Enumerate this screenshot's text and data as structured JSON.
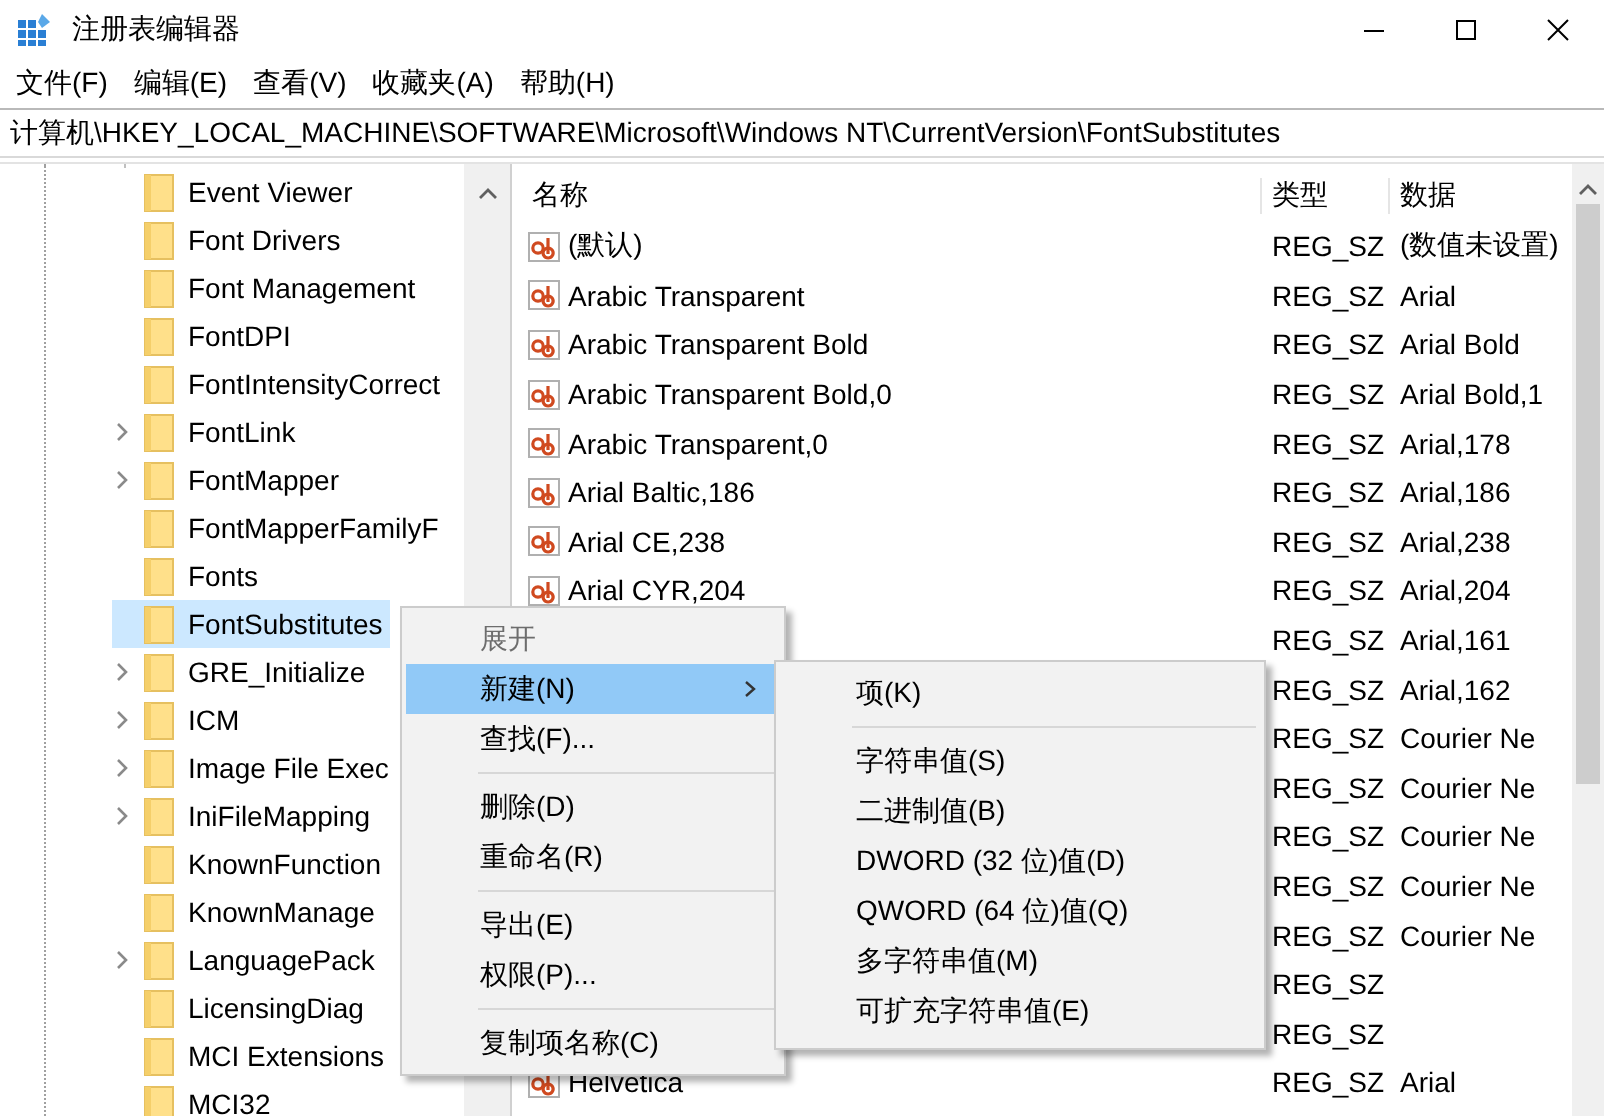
{
  "window": {
    "title": "注册表编辑器"
  },
  "menu_bar": [
    "文件(F)",
    "编辑(E)",
    "查看(V)",
    "收藏夹(A)",
    "帮助(H)"
  ],
  "address": "计算机\\HKEY_LOCAL_MACHINE\\SOFTWARE\\Microsoft\\Windows NT\\CurrentVersion\\FontSubstitutes",
  "tree": {
    "items": [
      {
        "label": "Event Viewer",
        "expandable": false,
        "selected": false
      },
      {
        "label": "Font Drivers",
        "expandable": false,
        "selected": false
      },
      {
        "label": "Font Management",
        "expandable": false,
        "selected": false
      },
      {
        "label": "FontDPI",
        "expandable": false,
        "selected": false
      },
      {
        "label": "FontIntensityCorrect",
        "expandable": false,
        "selected": false
      },
      {
        "label": "FontLink",
        "expandable": true,
        "selected": false
      },
      {
        "label": "FontMapper",
        "expandable": true,
        "selected": false
      },
      {
        "label": "FontMapperFamilyF",
        "expandable": false,
        "selected": false
      },
      {
        "label": "Fonts",
        "expandable": false,
        "selected": false
      },
      {
        "label": "FontSubstitutes",
        "expandable": false,
        "selected": true
      },
      {
        "label": "GRE_Initialize",
        "expandable": true,
        "selected": false
      },
      {
        "label": "ICM",
        "expandable": true,
        "selected": false
      },
      {
        "label": "Image File Exec",
        "expandable": true,
        "selected": false
      },
      {
        "label": "IniFileMapping",
        "expandable": true,
        "selected": false
      },
      {
        "label": "KnownFunction",
        "expandable": false,
        "selected": false
      },
      {
        "label": "KnownManage",
        "expandable": false,
        "selected": false
      },
      {
        "label": "LanguagePack",
        "expandable": true,
        "selected": false
      },
      {
        "label": "LicensingDiag",
        "expandable": false,
        "selected": false
      },
      {
        "label": "MCI Extensions",
        "expandable": false,
        "selected": false
      },
      {
        "label": "MCI32",
        "expandable": false,
        "selected": false
      }
    ]
  },
  "list": {
    "columns": [
      "名称",
      "类型",
      "数据"
    ],
    "rows": [
      {
        "name": "(默认)",
        "type": "REG_SZ",
        "data": "(数值未设置)"
      },
      {
        "name": "Arabic Transparent",
        "type": "REG_SZ",
        "data": "Arial"
      },
      {
        "name": "Arabic Transparent Bold",
        "type": "REG_SZ",
        "data": "Arial Bold"
      },
      {
        "name": "Arabic Transparent Bold,0",
        "type": "REG_SZ",
        "data": "Arial Bold,1"
      },
      {
        "name": "Arabic Transparent,0",
        "type": "REG_SZ",
        "data": "Arial,178"
      },
      {
        "name": "Arial Baltic,186",
        "type": "REG_SZ",
        "data": "Arial,186"
      },
      {
        "name": "Arial CE,238",
        "type": "REG_SZ",
        "data": "Arial,238"
      },
      {
        "name": "Arial CYR,204",
        "type": "REG_SZ",
        "data": "Arial,204"
      },
      {
        "type": "REG_SZ",
        "data": "Arial,161"
      },
      {
        "type": "REG_SZ",
        "data": "Arial,162"
      },
      {
        "type": "REG_SZ",
        "data": "Courier Ne"
      },
      {
        "type": "REG_SZ",
        "data": "Courier Ne"
      },
      {
        "type": "REG_SZ",
        "data": "Courier Ne"
      },
      {
        "type": "REG_SZ",
        "data": "Courier Ne"
      },
      {
        "type": "REG_SZ",
        "data": "Courier Ne"
      },
      {
        "type": "REG_SZ"
      },
      {
        "type": "REG_SZ"
      },
      {
        "name": "Helvetica",
        "type": "REG_SZ",
        "data": "Arial"
      }
    ]
  },
  "context_menu": {
    "items": [
      {
        "kind": "item",
        "label": "展开",
        "disabled": true,
        "selected": false,
        "submenu": false
      },
      {
        "kind": "item",
        "label": "新建(N)",
        "disabled": false,
        "selected": true,
        "submenu": true
      },
      {
        "kind": "item",
        "label": "查找(F)...",
        "disabled": false,
        "selected": false,
        "submenu": false
      },
      {
        "kind": "separator"
      },
      {
        "kind": "item",
        "label": "删除(D)",
        "disabled": false,
        "selected": false,
        "submenu": false
      },
      {
        "kind": "item",
        "label": "重命名(R)",
        "disabled": false,
        "selected": false,
        "submenu": false
      },
      {
        "kind": "separator"
      },
      {
        "kind": "item",
        "label": "导出(E)",
        "disabled": false,
        "selected": false,
        "submenu": false
      },
      {
        "kind": "item",
        "label": "权限(P)...",
        "disabled": false,
        "selected": false,
        "submenu": false
      },
      {
        "kind": "separator"
      },
      {
        "kind": "item",
        "label": "复制项名称(C)",
        "disabled": false,
        "selected": false,
        "submenu": false
      }
    ]
  },
  "submenu": {
    "items": [
      {
        "kind": "item",
        "label": "项(K)",
        "disabled": false,
        "selected": false,
        "submenu": false
      },
      {
        "kind": "separator"
      },
      {
        "kind": "item",
        "label": "字符串值(S)",
        "disabled": false,
        "selected": false,
        "submenu": false
      },
      {
        "kind": "item",
        "label": "二进制值(B)",
        "disabled": false,
        "selected": false,
        "submenu": false
      },
      {
        "kind": "item",
        "label": "DWORD (32 位)值(D)",
        "disabled": false,
        "selected": false,
        "submenu": false
      },
      {
        "kind": "item",
        "label": "QWORD (64 位)值(Q)",
        "disabled": false,
        "selected": false,
        "submenu": false
      },
      {
        "kind": "item",
        "label": "多字符串值(M)",
        "disabled": false,
        "selected": false,
        "submenu": false
      },
      {
        "kind": "item",
        "label": "可扩充字符串值(E)",
        "disabled": false,
        "selected": false,
        "submenu": false
      }
    ]
  }
}
